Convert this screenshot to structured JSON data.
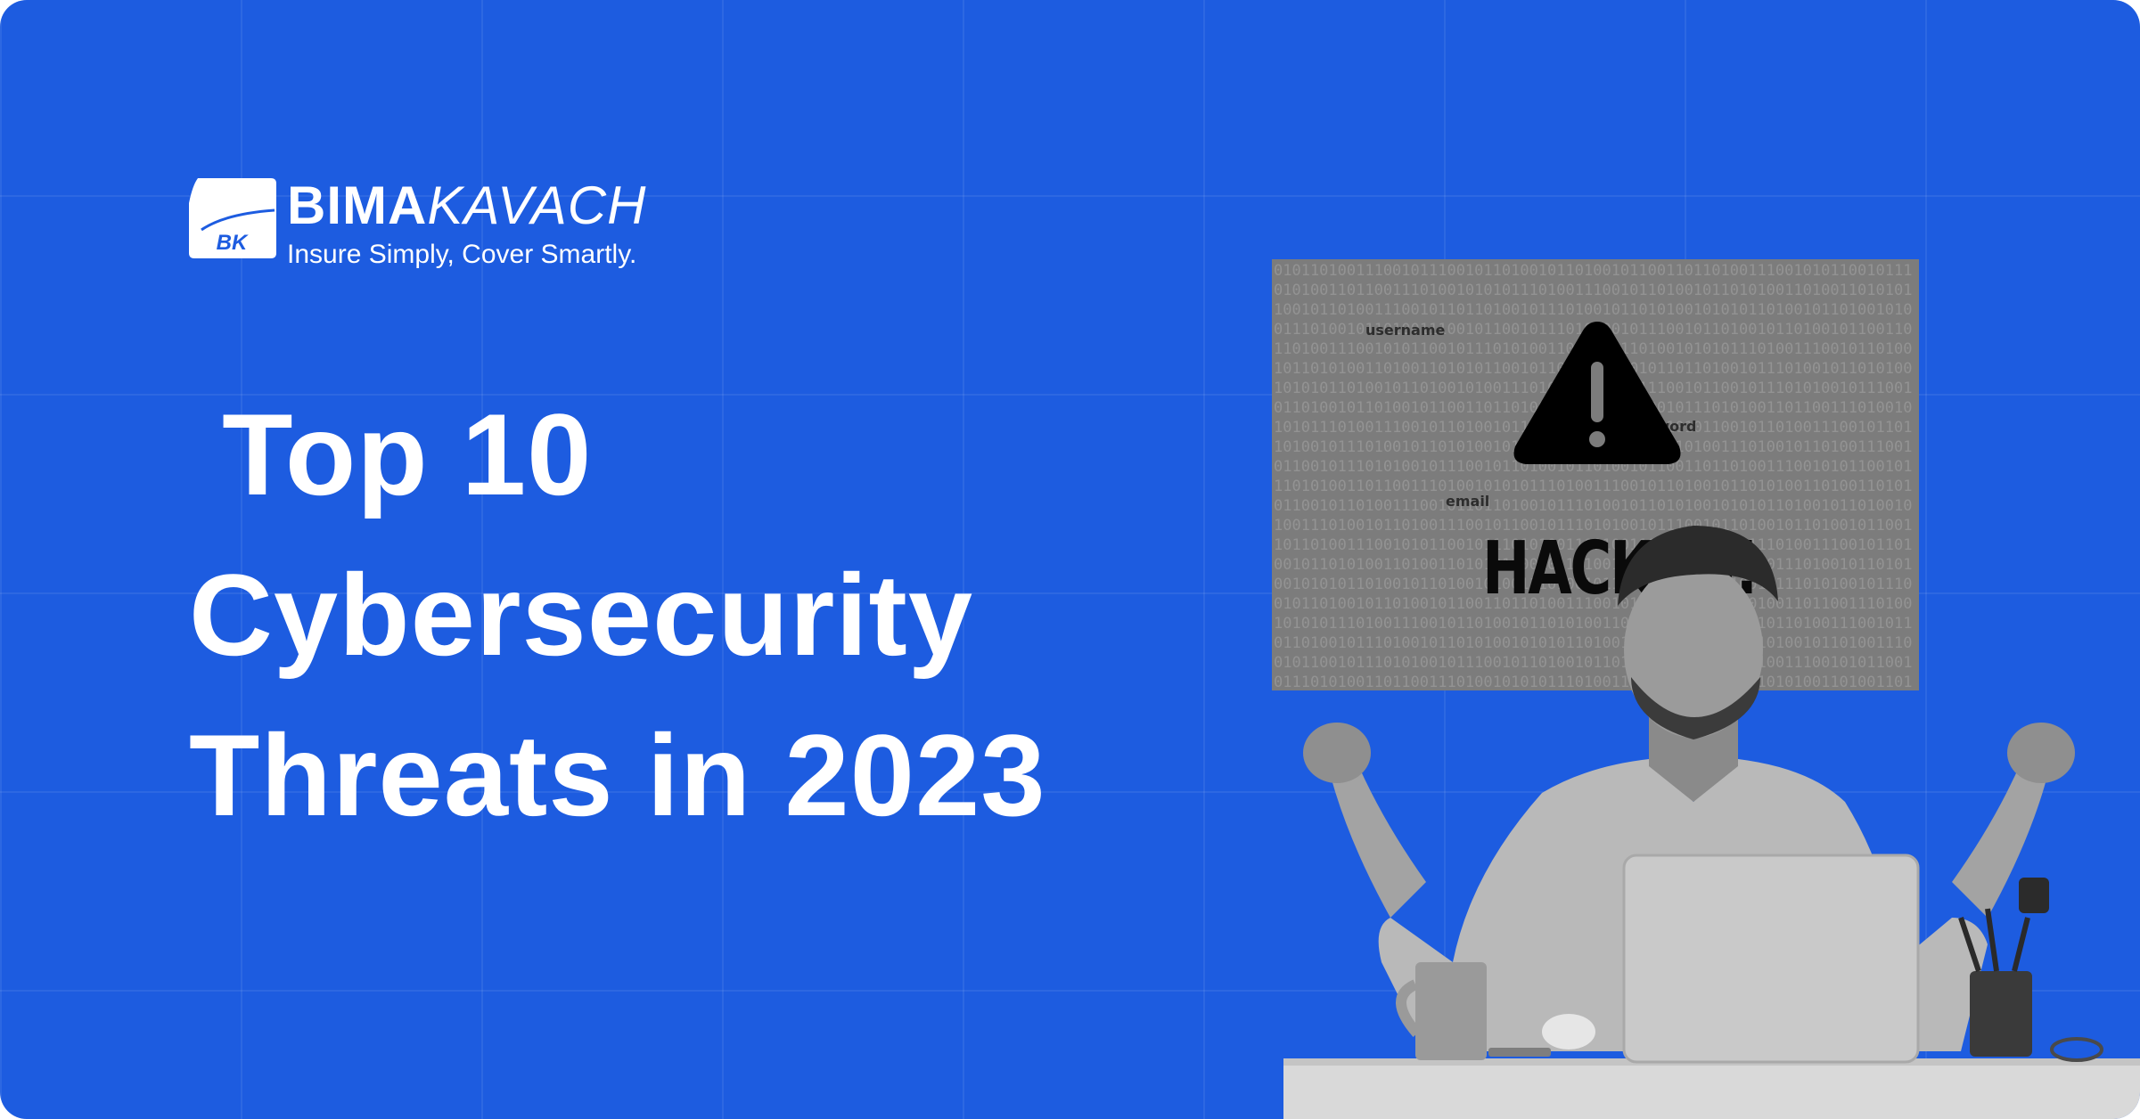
{
  "brand": {
    "mark_text": "BK",
    "name_bold": "BIMA",
    "name_light": "KAVACH",
    "tagline": "Insure Simply, Cover Smartly."
  },
  "headline": {
    "line1": " Top 10",
    "line2": "Cybersecurity",
    "line3": "Threats in 2023"
  },
  "screen": {
    "binary_text": "010110100111001011100101101001011010010110011011010011100101011001011101010011011001110100101010111010011100101101001011010100110100110101011001011010011100101101101001011101001011010100101010110100101101001010011101001011010011100101100101110101001011100101101001011010010110011011010011100101011001011101010011011001110100101010111010011100101101001011010100110100110101011001011010011100101101101001011101001011010100101010110100101101001010011101001011010011100101100101110101001011100101101001011010010110011011010011100101011001011101010011011001110100101010111010011100101101001011010100110100110101011001011010011100101101101001011101001011010100101010110100101101001010011101001011010011100101100101110101001011100101101001011010010110011011010011100101011001011101010011011001110100101010111010011100101101001011010100110100110101011001011010011100101101101001011101001011010100101010110100101101001010011101001011010011100101100101110101001011100101101001011010010110011011010011100101011001011101010011011001110100101010111010011100101101001011010100110100110101011001011010011100101101101001011101001011010100101010110100101101001010011101001011010011100101100101110101001011100101101001011010010110011011010011100101011001011101010011011001110100101010111010011100101101001011010100110100110101011001011010011100101101101001011101001011010100101010110100101101001010011101001011010011100101100101110101001011100101101001011010010110011011010011100101011001011101010011011001110100101010111010011100101101001011010100110100110101011001011010011100101101101001011101001011010100101010110100101101001010011101001011010011100101100101110101001011100101101001011010010110011011010011100101011001011101010011011001110100101010111010011100101101001011010100110100110101011001011010011100101101101001011101001011010100101010110100101101001010011101001011010011100101100101110101001011100101101001011010010110011011010011100101011001011101010011011001110100101010111010011100101101001011010100110100110101011001011010011100101101101001011101001011010100101010110100101101001010011101001011010011100101100101110101001011100101101001011010010110011011010011100101011001011101010011011001110100101010111010011100101101001011010100110100110101011001011010011100101101101001011101001011010100101010110100101101001010011101001011010011100101100101110101001011100101101001011010010110011011010011100101011001011101010011011001110100101010111010011100101101001011010100110100110101011001011010011100101101101001011101001011010100101010110100101101001010011101001011010011100101100101110101001011100101101001011010010110011011010011100101011001011101010011011001110100101010111010011100101101001011010100110100110101011001011010011100101101101001011101001011010100101010110100101101001010011101001011010011100101100101110101001011100101101001011010010110011011010011100101011001011101010011011001110100101010111010011100101101001011010100110100110101011001011010011100101101101001011101001011010100101010110100101101001010011101001011010011100101100101110101001011100101101001011010010110011011010011100101011001011101010011011001110100101010111010011100101101001011010100110100110101011001011010011100101101101001011101001011010100101010110100101101001010011101001011010011100101100101110101001011100101101001011010010110011011010011100101011001011101010011011001110100101010111010011100101101001011010100110100110101011001011010011100101101101001011101001011010100101010110100101101001010011101001011010011100101100101110101001011100101101001011010010110011011010011100101011001011101010011011001110100101010111010011100101101001011010100110100110101011001011010011100101101101001011101001011010100101010110100101101001010011101001011010011100101100101110101",
    "label_username": "username",
    "label_password": "password",
    "label_email": "email",
    "hacked_text": "HACKED!"
  },
  "icons": {
    "warning": "warning-triangle-icon",
    "logo": "bk-shield-logo-icon"
  },
  "colors": {
    "background": "#1d5ce0",
    "text": "#ffffff",
    "screen": "#7c7c7c"
  }
}
